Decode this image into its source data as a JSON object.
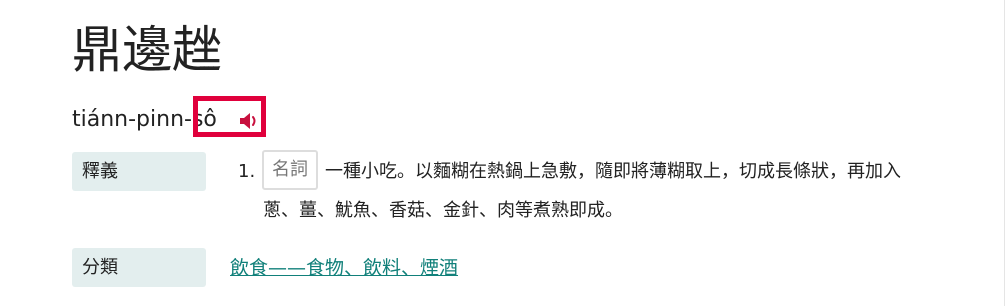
{
  "entry": {
    "headword": "鼎邊趖",
    "romanization": "tiánn-pinn-sô",
    "audio": {
      "icon": "speaker-icon",
      "highlight_color": "#e0003c"
    }
  },
  "definition": {
    "label": "釋義",
    "number": "1.",
    "part_of_speech": "名詞",
    "text_line_1": "一種小吃。以麵糊在熱鍋上急敷，隨即將薄糊取上，切成長條狀，再加入",
    "text_line_2": "蔥、薑、魷魚、香菇、金針、肉等煮熟即成。"
  },
  "category": {
    "label": "分類",
    "link_text": "飲食——食物、飲料、煙酒",
    "link_color": "#11807a"
  }
}
